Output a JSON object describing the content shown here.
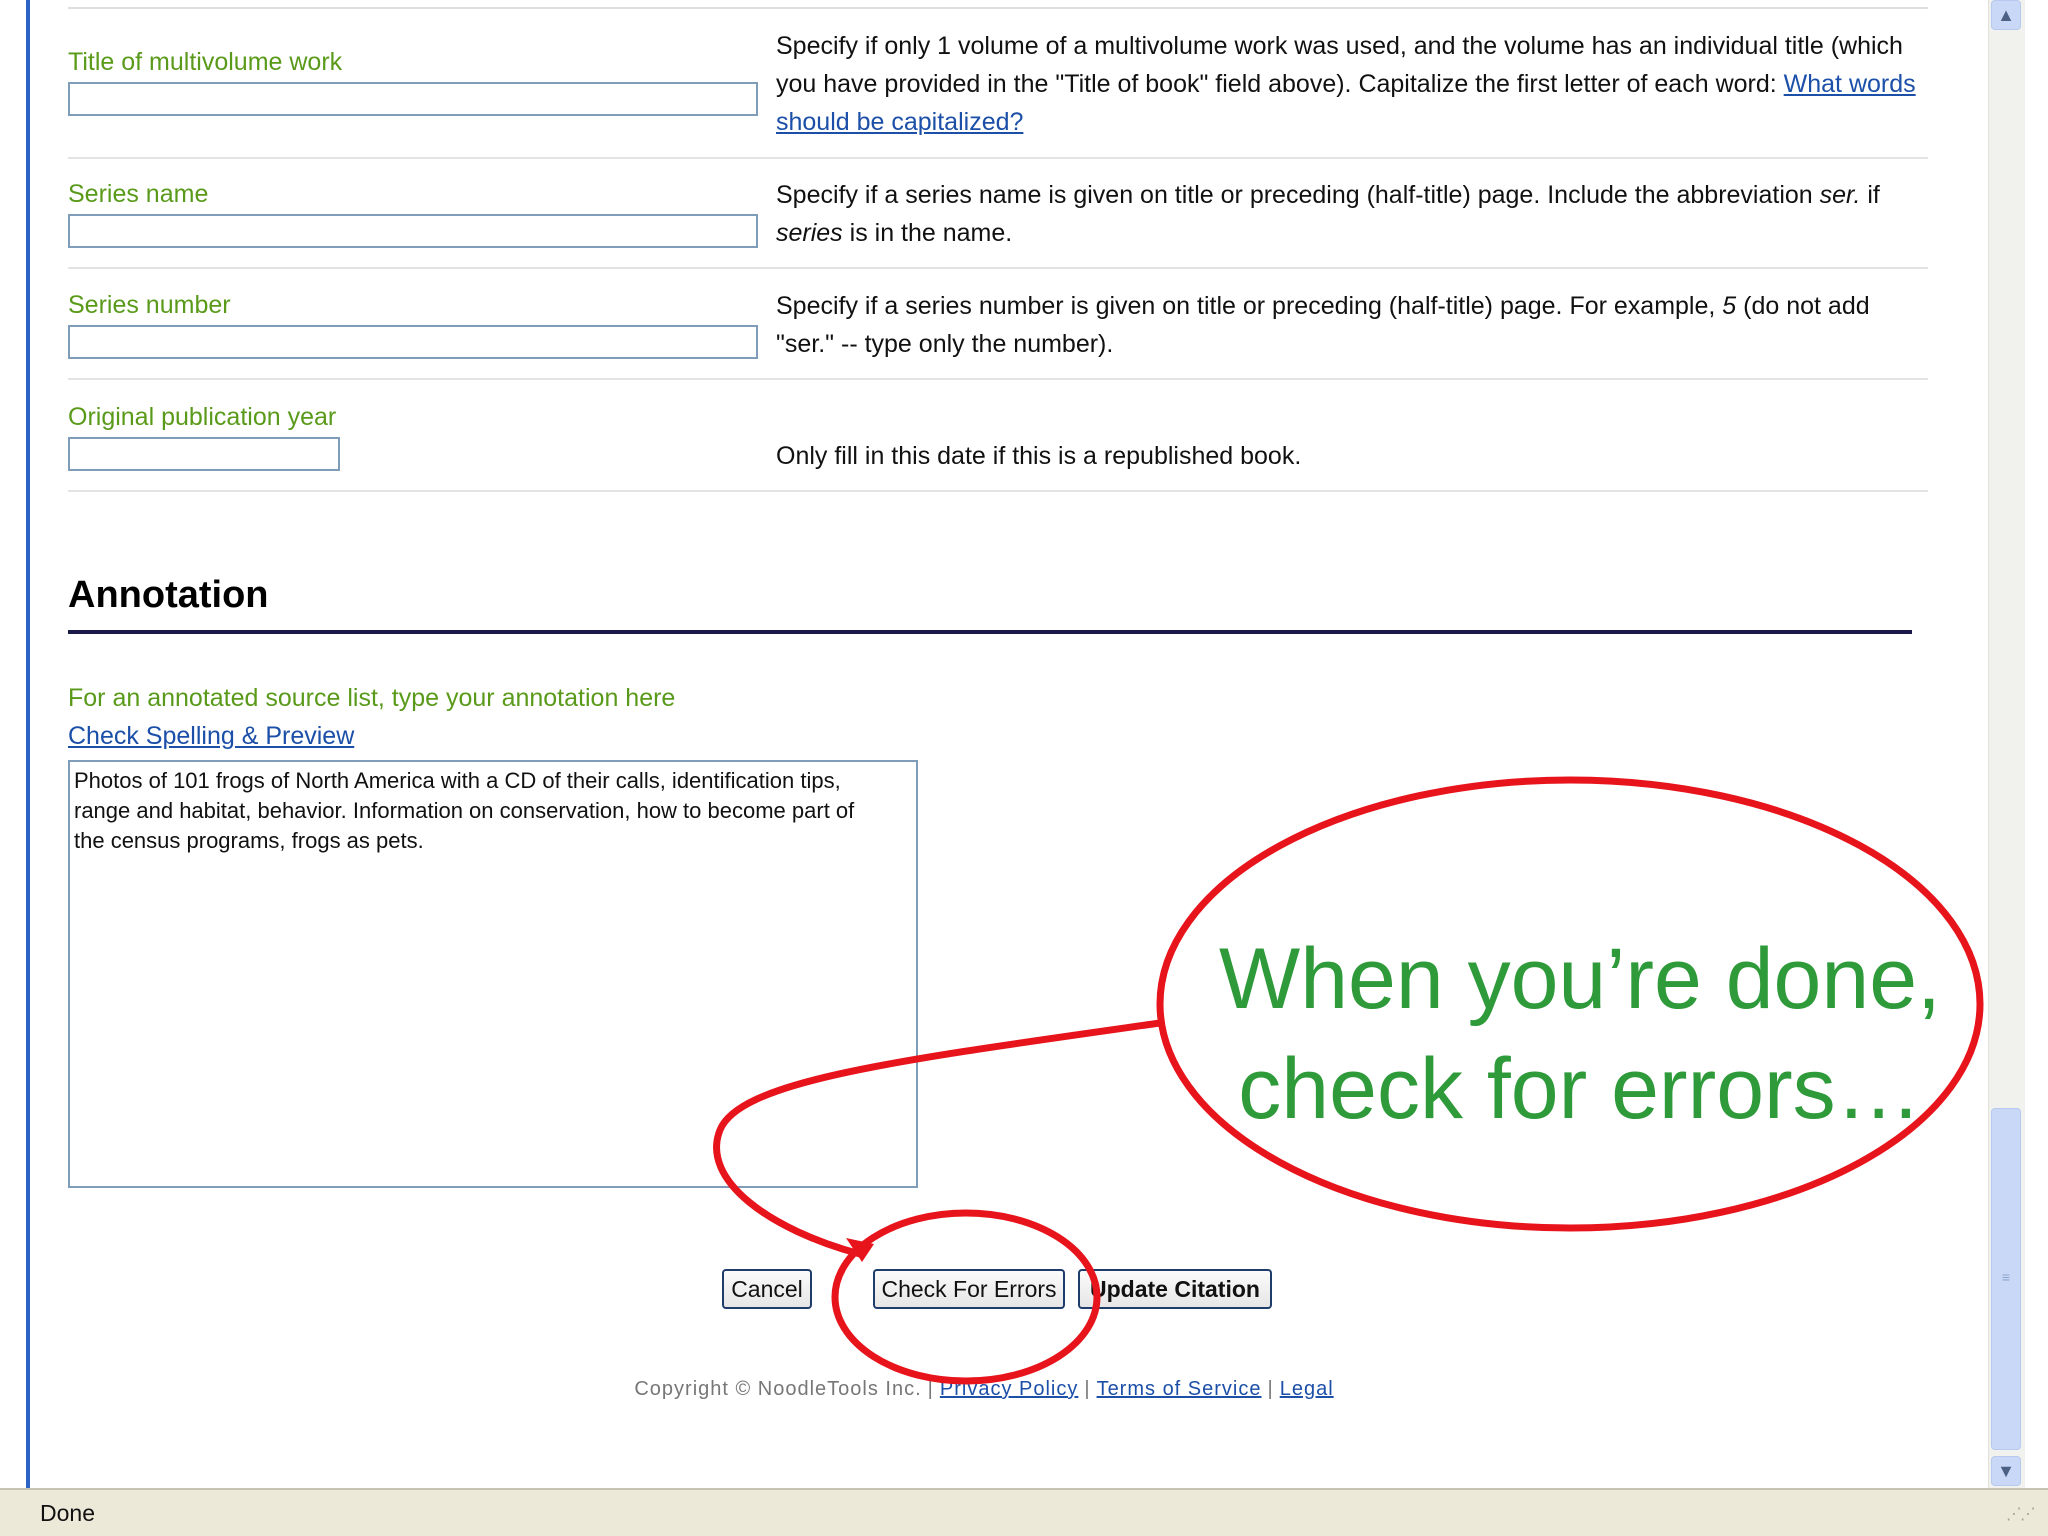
{
  "fields": [
    {
      "label": "Title of multivolume work",
      "value": "",
      "help_pre": "Specify if only 1 volume of a multivolume work was used, and the volume has an individual title (which you have provided in the \"Title of book\" field above). Capitalize the first letter of each word: ",
      "help_link": "What words should be capitalized?"
    },
    {
      "label": "Series name",
      "value": "",
      "help_1": "Specify if a series name is given on title or preceding (half-title) page. Include the abbreviation ",
      "help_em1": "ser.",
      "help_2": " if ",
      "help_em2": "series",
      "help_3": " is in the name."
    },
    {
      "label": "Series number",
      "value": "",
      "help_1": "Specify if a series number is given on title or preceding (half-title) page. For example, ",
      "help_em1": "5",
      "help_2": " (do not add \"ser.\" -- type only the number)."
    },
    {
      "label": "Original publication year",
      "value": "",
      "help": "Only fill in this date if this is a republished book."
    }
  ],
  "annotation": {
    "title": "Annotation",
    "label": "For an annotated source list, type your annotation here",
    "preview_link": "Check Spelling & Preview",
    "text": "Photos of 101 frogs of North America with a CD of their calls, identification tips,\nrange and habitat, behavior. Information on conservation, how to become part of\nthe census programs, frogs as pets."
  },
  "buttons": {
    "cancel": "Cancel",
    "check_errors": "Check For Errors",
    "update": "Update Citation"
  },
  "footer": {
    "copyright": "Copyright © NoodleTools Inc.",
    "privacy": "Privacy Policy",
    "terms": "Terms of Service",
    "legal": "Legal"
  },
  "callout": {
    "line1": "When you’re done,",
    "line2": "check for errors…"
  },
  "statusbar": {
    "text": "Done"
  },
  "colors": {
    "label_green": "#5a9a1a",
    "callout_green": "#2e9a3a",
    "callout_red": "#e8141c",
    "link_blue": "#1b4fa8"
  },
  "icons": {
    "scroll_up": "chevron-up-icon",
    "scroll_down": "chevron-down-icon",
    "grip": "resize-grip-icon"
  }
}
